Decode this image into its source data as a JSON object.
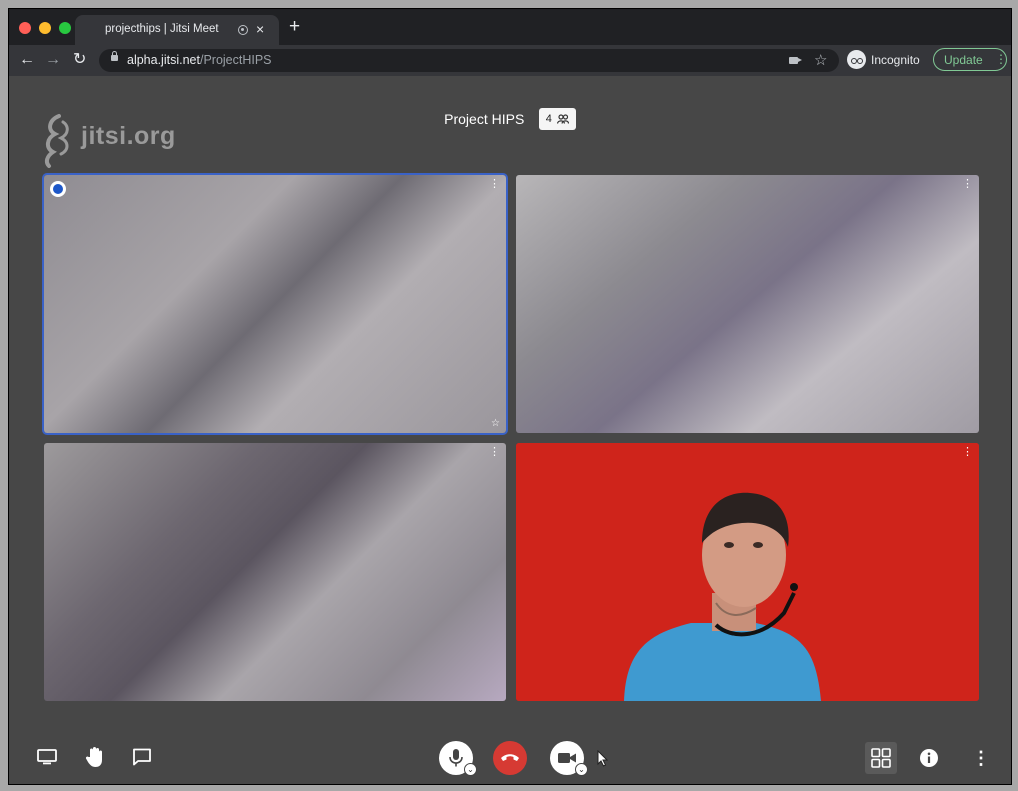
{
  "browser": {
    "tab": {
      "title": "projecthips | Jitsi Meet",
      "close": "×",
      "new_tab": "+"
    },
    "nav": {
      "back": "←",
      "forward": "→",
      "reload": "↻"
    },
    "url_host": "alpha.jitsi.net",
    "url_path": "/ProjectHIPS",
    "bookmark_star": "☆",
    "incognito_label": "Incognito",
    "update_label": "Update",
    "update_menu": "⋮"
  },
  "meeting": {
    "logo_text": "jitsi.org",
    "title": "Project HIPS",
    "participant_count": "4",
    "tile_menu": "⋮",
    "tile_star": "☆"
  },
  "toolbar": {
    "more_actions": "⋮"
  },
  "colors": {
    "active_border": "#3a62c7",
    "hangup_red": "#d63a33",
    "update_green": "#81c995",
    "meeting_bg": "#474747"
  },
  "icons": [
    "screen-share-icon",
    "raise-hand-icon",
    "chat-icon",
    "microphone-icon",
    "hang-up-icon",
    "camera-icon",
    "tile-view-icon",
    "info-icon",
    "more-icon",
    "participants-icon",
    "cursor-icon"
  ]
}
